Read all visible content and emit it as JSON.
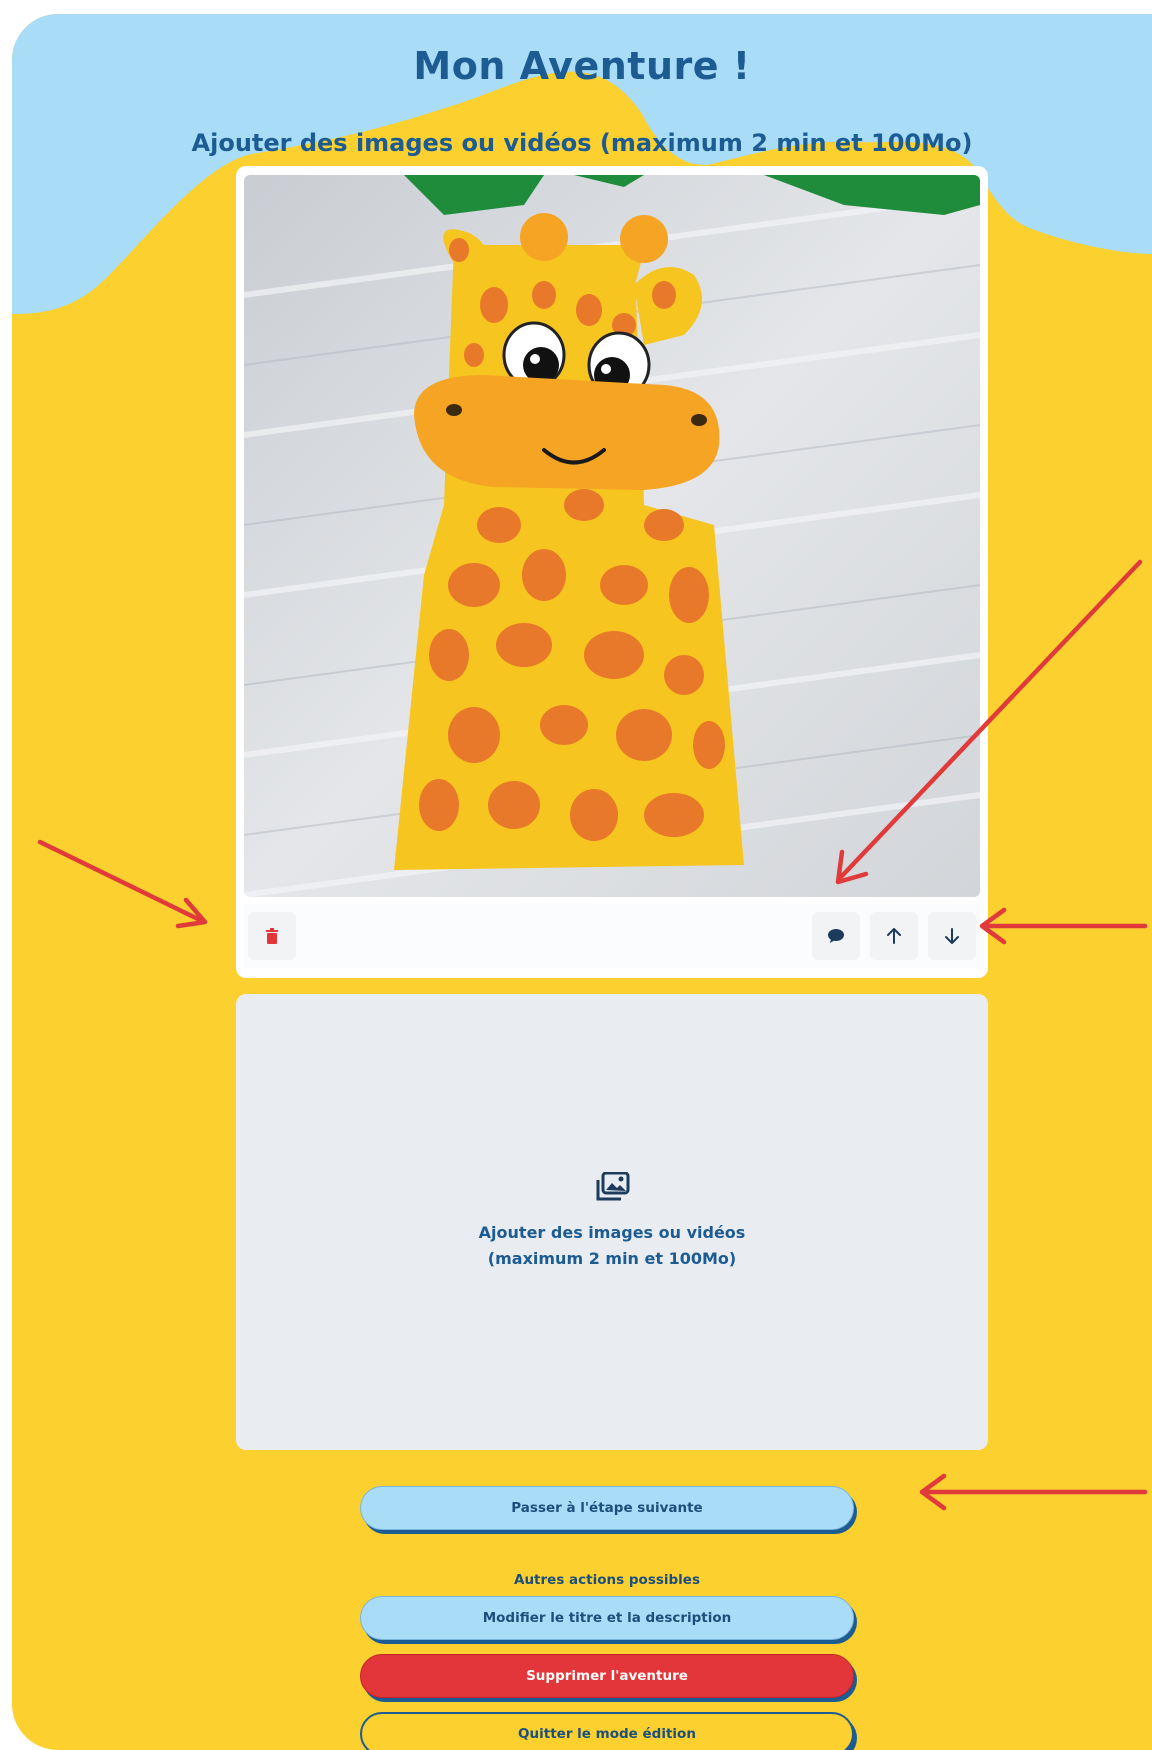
{
  "header": {
    "title": "Mon Aventure !",
    "subtitle": "Ajouter des images ou vidéos (maximum 2 min et 100Mo)"
  },
  "media_item": {
    "image_alt": "giraffe-paper-bag-puppet",
    "toolbar": {
      "delete_icon": "trash-icon",
      "comment_icon": "speech-bubble-icon",
      "up_icon": "arrow-up-icon",
      "down_icon": "arrow-down-icon"
    }
  },
  "dropzone": {
    "icon": "add-photos-icon",
    "line1": "Ajouter des images ou vidéos",
    "line2": "(maximum 2 min et 100Mo)"
  },
  "actions": {
    "next_step": "Passer à l'étape suivante",
    "other_label": "Autres actions possibles",
    "edit_title": "Modifier le titre et la description",
    "delete_adventure": "Supprimer l'aventure",
    "quit_edit": "Quitter le mode édition"
  },
  "colors": {
    "background_yellow": "#fbd02f",
    "sky_blue": "#a9dcf7",
    "primary_text": "#1d5c92",
    "danger_red": "#e2363a",
    "annotation_arrow": "#e03a3a"
  }
}
